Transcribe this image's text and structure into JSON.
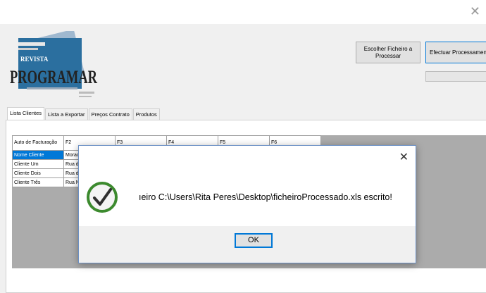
{
  "window": {
    "close_glyph": "✕"
  },
  "logo": {
    "top_text": "REVISTA",
    "main_text": "PROGRAMAR"
  },
  "buttons": {
    "choose_file": "Escolher Ficheiro a Processar",
    "process": "Efectuar Processamento"
  },
  "tabs": [
    "Lista Clientes",
    "Lista a Exportar",
    "Preços Contrato",
    "Produtos"
  ],
  "grid": {
    "headers": [
      "Auto de Facturação",
      "F2",
      "F3",
      "F4",
      "F5",
      "F6"
    ],
    "rows": [
      [
        "Nome Cliente",
        "Morad"
      ],
      [
        "Cliente Um",
        "Rua d"
      ],
      [
        "Cliente Dois",
        "Rua d"
      ],
      [
        "Cliente Três",
        "Rua N"
      ]
    ]
  },
  "dialog": {
    "close_glyph": "✕",
    "message": "ıeiro C:\\Users\\Rita Peres\\Desktop\\ficheiroProcessado.xls escrito!",
    "ok_label": "OK"
  },
  "colors": {
    "accent": "#0078d7",
    "logo_blue": "#1a6fa8",
    "grid_bg": "#ababab",
    "check_green": "#3c8a2e"
  }
}
